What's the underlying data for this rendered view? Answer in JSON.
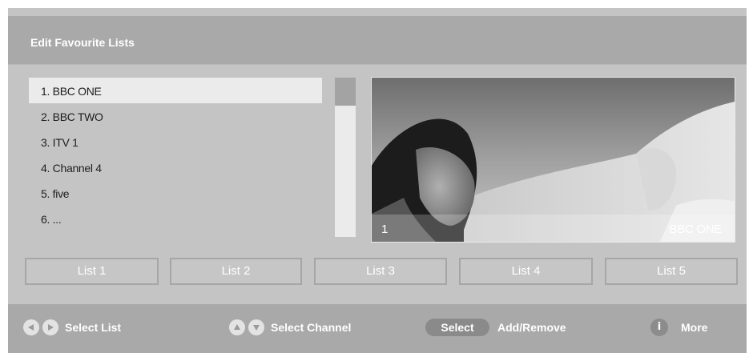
{
  "header": {
    "title": "Edit Favourite Lists"
  },
  "channels": [
    {
      "label": "1. BBC ONE",
      "selected": true
    },
    {
      "label": "2. BBC TWO"
    },
    {
      "label": "3. ITV 1"
    },
    {
      "label": "4. Channel 4"
    },
    {
      "label": "5. five"
    },
    {
      "label": "6. ..."
    }
  ],
  "preview": {
    "channel_number": "1",
    "channel_name": "BBC ONE"
  },
  "lists": [
    "List 1",
    "List 2",
    "List 3",
    "List 4",
    "List 5"
  ],
  "footer": {
    "select_list": "Select List",
    "select_channel": "Select Channel",
    "select_key": "Select",
    "add_remove": "Add/Remove",
    "info_key": "i",
    "more": "More"
  },
  "icons": {
    "left": "left-arrow-icon",
    "right": "right-arrow-icon",
    "up": "up-arrow-icon",
    "down": "down-arrow-icon"
  },
  "colors": {
    "panel": "#c4c4c4",
    "header": "#a9a9a9",
    "highlight": "#ebebeb",
    "key": "#8a8a8a"
  }
}
